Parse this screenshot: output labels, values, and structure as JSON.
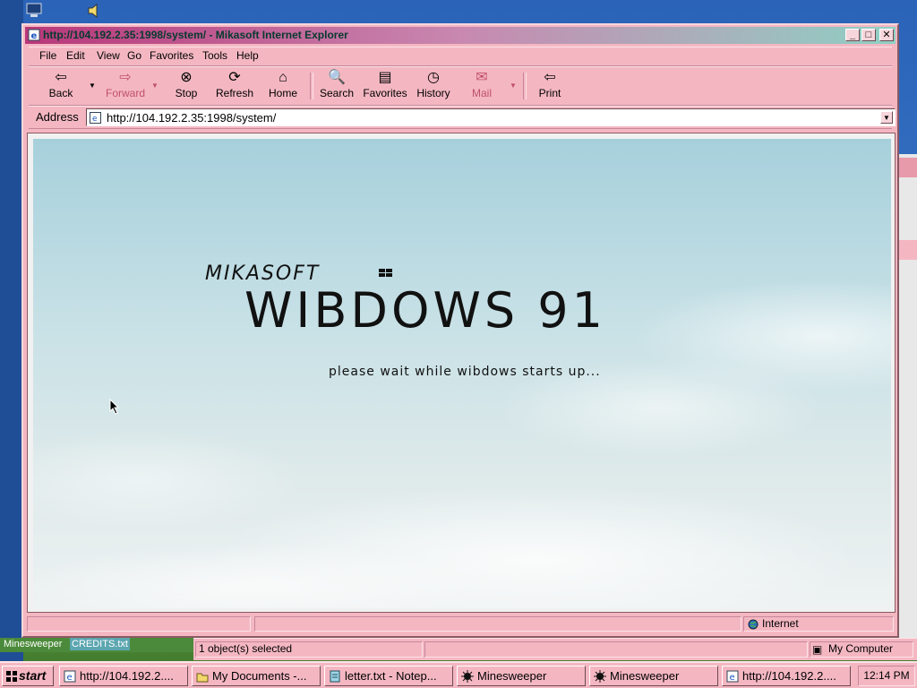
{
  "window": {
    "title": "http://104.192.2.35:1998/system/ - Mikasoft Internet Explorer",
    "controls": {
      "minimize": "_",
      "maximize": "□",
      "close": "✕"
    }
  },
  "menu": [
    "File",
    "Edit",
    "View",
    "Go",
    "Favorites",
    "Tools",
    "Help"
  ],
  "toolbar": {
    "back": "Back",
    "forward": "Forward",
    "stop": "Stop",
    "refresh": "Refresh",
    "home": "Home",
    "search": "Search",
    "favorites": "Favorites",
    "history": "History",
    "mail": "Mail",
    "print": "Print"
  },
  "address": {
    "label": "Address",
    "url": "http://104.192.2.35:1998/system/"
  },
  "page": {
    "brand": "MIKASOFT",
    "os_title": "WIBDOWS 91",
    "boot_message": "please wait while wibdows starts up..."
  },
  "status": {
    "zone": "Internet"
  },
  "explorer_status": {
    "selection": "1 object(s) selected",
    "location": "My Computer"
  },
  "desktop_tags": [
    "Minesweeper",
    "CREDITS.txt"
  ],
  "taskbar": {
    "start": "start",
    "buttons": [
      {
        "label": "http://104.192.2....",
        "icon": "ie-icon"
      },
      {
        "label": "My Documents -...",
        "icon": "folder-icon"
      },
      {
        "label": "letter.txt - Notep...",
        "icon": "notepad-icon"
      },
      {
        "label": "Minesweeper",
        "icon": "mine-icon"
      },
      {
        "label": "Minesweeper",
        "icon": "mine-icon"
      },
      {
        "label": "http://104.192.2....",
        "icon": "ie-icon"
      }
    ],
    "clock": "12:14 PM"
  },
  "colors": {
    "chrome": "#f4b7c2",
    "title_gradient_start": "#b8387a",
    "title_gradient_end": "#8fd0c4",
    "disabled_text": "#c0506a"
  }
}
